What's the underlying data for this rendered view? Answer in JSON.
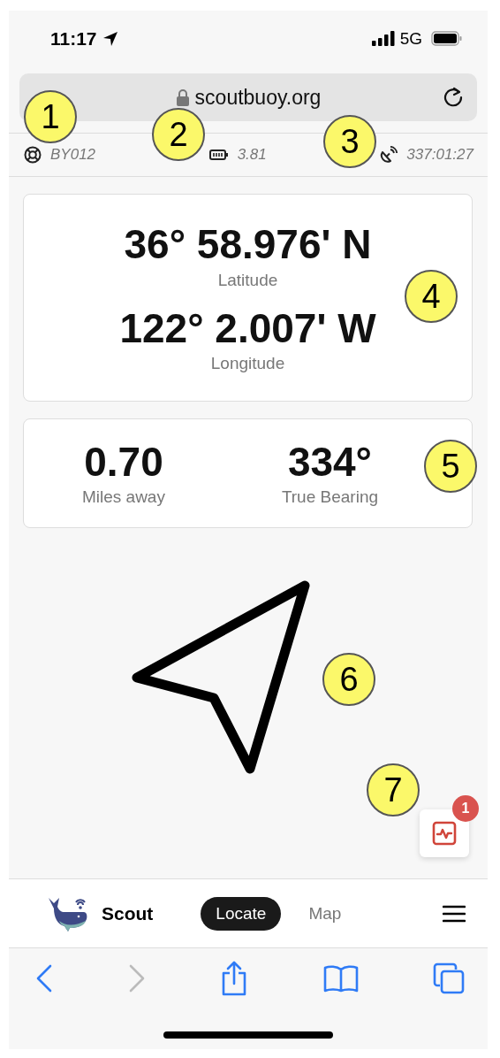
{
  "status_bar": {
    "time": "11:17",
    "network": "5G"
  },
  "browser": {
    "url": "scoutbuoy.org"
  },
  "info_bar": [
    {
      "kind": "buoy",
      "text": "BY012"
    },
    {
      "kind": "battery",
      "text": "3.81"
    },
    {
      "kind": "satellite",
      "text": "337:01:27"
    }
  ],
  "position": [
    {
      "value": "36° 58.976' N",
      "label": "Latitude"
    },
    {
      "value": "122° 2.007' W",
      "label": "Longitude"
    }
  ],
  "stats": [
    {
      "value": "0.70",
      "label": "Miles away"
    },
    {
      "value": "334°",
      "label": "True Bearing"
    }
  ],
  "alerts_button": {
    "badge": "1"
  },
  "nav": {
    "brand": "Scout",
    "tabs": [
      {
        "label": "Locate",
        "selected": true
      },
      {
        "label": "Map",
        "selected": false
      }
    ]
  },
  "toolbar": [
    {
      "kind": "back",
      "disabled": false
    },
    {
      "kind": "forward",
      "disabled": true
    },
    {
      "kind": "share",
      "disabled": false
    },
    {
      "kind": "bookmarks",
      "disabled": false
    },
    {
      "kind": "tabs",
      "disabled": false
    }
  ],
  "callouts": [
    "1",
    "2",
    "3",
    "4",
    "5",
    "6",
    "7"
  ]
}
